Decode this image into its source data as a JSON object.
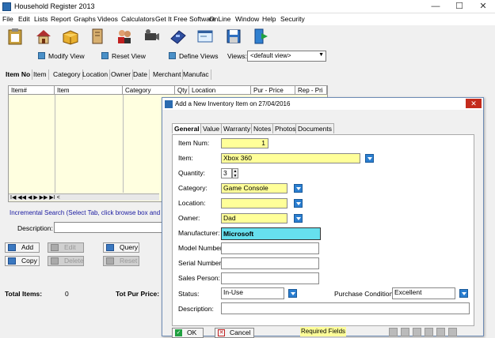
{
  "window": {
    "title": "Household Register 2013",
    "min": "—",
    "max": "☐",
    "close": "✕"
  },
  "menu": [
    "File",
    "Edit",
    "Lists",
    "Report",
    "Graphs",
    "Videos",
    "Calculators",
    "Get It Free Software",
    "OnLine",
    "Window",
    "Help",
    "Security"
  ],
  "viewbar": {
    "modify": "Modify View",
    "reset": "Reset View",
    "define": "Define Views",
    "views_label": "Views:",
    "views_value": "<default view>"
  },
  "main_tabs": [
    "Item No",
    "Item",
    "Category",
    "Location",
    "Owner",
    "Date",
    "Merchant",
    "Manufac"
  ],
  "grid_headers": [
    "Item#",
    "Item",
    "Category",
    "Qty",
    "Location",
    "Pur - Price",
    "Rep - Pri"
  ],
  "nav": "I◀ ◀◀ ◀ ▶ ▶▶ ▶I    <",
  "incremental": "Incremental Search (Select Tab, click browse box and type t",
  "description_label": "Description:",
  "buttons": {
    "add": "Add",
    "edit": "Edit",
    "query": "Query",
    "copy": "Copy",
    "delete": "Delete",
    "reset": "Reset"
  },
  "totals": {
    "items_label": "Total Items:",
    "items_value": "0",
    "pur_label": "Tot Pur Price:"
  },
  "dialog": {
    "title": "Add a New Inventory Item on 27/04/2016",
    "tabs": [
      "General",
      "Value",
      "Warranty",
      "Notes",
      "Photos",
      "Documents"
    ],
    "item_num_label": "Item Num:",
    "item_num": "1",
    "item_label": "Item:",
    "item": "Xbox 360",
    "quantity_label": "Quantity:",
    "quantity": "3",
    "category_label": "Category:",
    "category": "Game Console",
    "location_label": "Location:",
    "location": "",
    "owner_label": "Owner:",
    "owner": "Dad",
    "manufacturer_label": "Manufacturer: >",
    "manufacturer": "Microsoft",
    "model_label": "Model Number:",
    "serial_label": "Serial Number:",
    "salesperson_label": "Sales Person:",
    "status_label": "Status:",
    "status": "In-Use",
    "condition_label": "Purchase Condition:",
    "condition": "Excellent",
    "description_label": "Description:",
    "ok": "OK",
    "cancel": "Cancel",
    "required": "Required Fields"
  }
}
